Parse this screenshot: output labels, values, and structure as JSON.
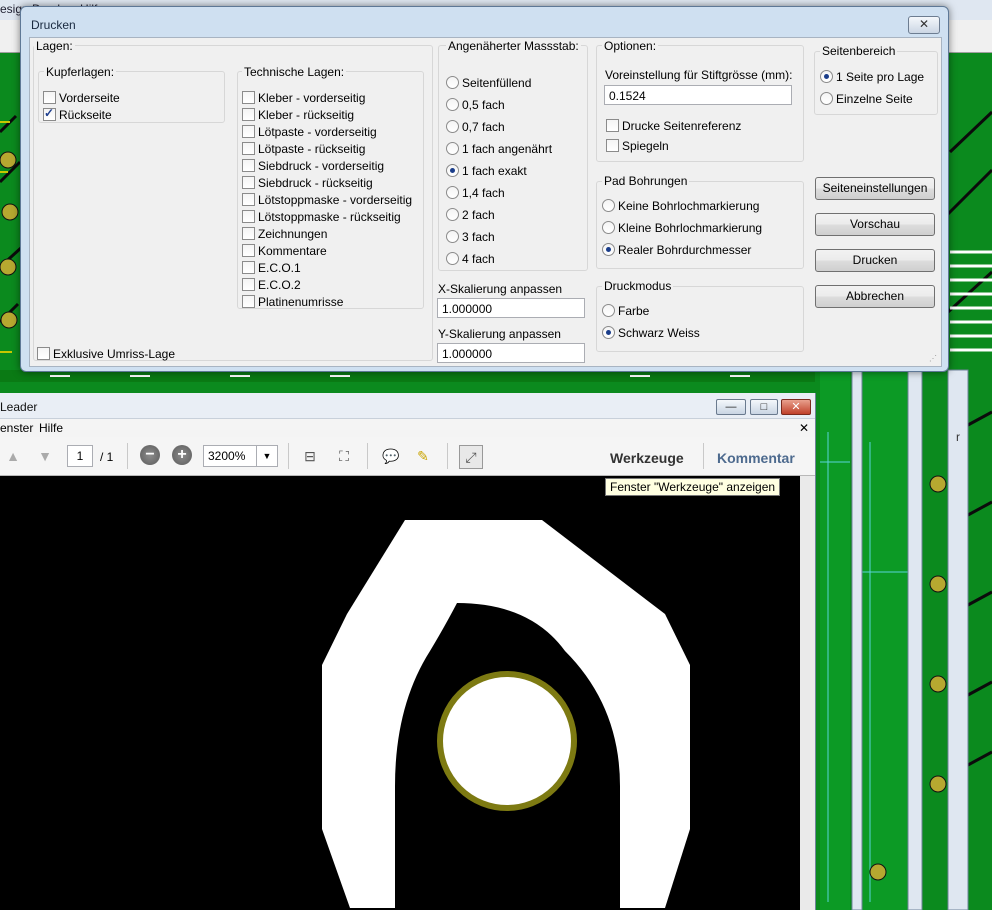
{
  "background": {
    "titlebar_text": "esign  Drucken  Hilfe",
    "right_panel_label": "r"
  },
  "print_dialog": {
    "title": "Drucken",
    "close_glyph": "✕",
    "layers": {
      "label": "Lagen:",
      "copper_label": "Kupferlagen:",
      "copper": [
        {
          "label": "Vorderseite",
          "checked": false
        },
        {
          "label": "Rückseite",
          "checked": true
        }
      ],
      "technical_label": "Technische Lagen:",
      "technical": [
        {
          "label": "Kleber - vorderseitig",
          "checked": false
        },
        {
          "label": "Kleber - rückseitig",
          "checked": false
        },
        {
          "label": "Lötpaste - vorderseitig",
          "checked": false
        },
        {
          "label": "Lötpaste - rückseitig",
          "checked": false
        },
        {
          "label": "Siebdruck - vorderseitig",
          "checked": false
        },
        {
          "label": "Siebdruck - rückseitig",
          "checked": false
        },
        {
          "label": "Lötstoppmaske - vorderseitig",
          "checked": false
        },
        {
          "label": "Lötstoppmaske - rückseitig",
          "checked": false
        },
        {
          "label": "Zeichnungen",
          "checked": false
        },
        {
          "label": "Kommentare",
          "checked": false
        },
        {
          "label": "E.C.O.1",
          "checked": false
        },
        {
          "label": "E.C.O.2",
          "checked": false
        },
        {
          "label": "Platinenumrisse",
          "checked": false
        }
      ],
      "exclusive_label": "Exklusive Umriss-Lage",
      "exclusive_checked": false
    },
    "scale": {
      "label": "Angenäherter Massstab:",
      "options": [
        {
          "label": "Seitenfüllend",
          "checked": false
        },
        {
          "label": "0,5 fach",
          "checked": false
        },
        {
          "label": "0,7 fach",
          "checked": false
        },
        {
          "label": "1 fach angenährt",
          "checked": false
        },
        {
          "label": "1 fach exakt",
          "checked": true
        },
        {
          "label": "1,4 fach",
          "checked": false
        },
        {
          "label": "2 fach",
          "checked": false
        },
        {
          "label": "3 fach",
          "checked": false
        },
        {
          "label": "4 fach",
          "checked": false
        }
      ],
      "x_label": "X-Skalierung anpassen",
      "x_value": "1.000000",
      "y_label": "Y-Skalierung anpassen",
      "y_value": "1.000000"
    },
    "options": {
      "label": "Optionen:",
      "pen_label": "Voreinstellung für Stiftgrösse (mm):",
      "pen_value": "0.1524",
      "page_ref_label": "Drucke Seitenreferenz",
      "page_ref_checked": false,
      "mirror_label": "Spiegeln",
      "mirror_checked": false
    },
    "pad_drill": {
      "label": "Pad Bohrungen",
      "options": [
        {
          "label": "Keine Bohrlochmarkierung",
          "checked": false
        },
        {
          "label": "Kleine Bohrlochmarkierung",
          "checked": false
        },
        {
          "label": "Realer Bohrdurchmesser",
          "checked": true
        }
      ]
    },
    "print_mode": {
      "label": "Druckmodus",
      "options": [
        {
          "label": "Farbe",
          "checked": false
        },
        {
          "label": "Schwarz Weiss",
          "checked": true
        }
      ]
    },
    "page_range": {
      "label": "Seitenbereich",
      "options": [
        {
          "label": "1 Seite pro Lage",
          "checked": true
        },
        {
          "label": "Einzelne Seite",
          "checked": false
        }
      ]
    },
    "buttons": {
      "page_setup": "Seiteneinstellungen",
      "preview": "Vorschau",
      "print": "Drucken",
      "cancel": "Abbrechen"
    }
  },
  "reader": {
    "title": "Leader",
    "minimize_glyph": "—",
    "maximize_glyph": "□",
    "close_glyph": "✕",
    "menu": [
      "enster",
      "Hilfe"
    ],
    "menu_close_glyph": "✕",
    "page_current": "1",
    "page_total": "/ 1",
    "zoom_value": "3200%",
    "zoom_out_glyph": "−",
    "zoom_in_glyph": "+",
    "tools_label": "Werkzeuge",
    "comment_label": "Kommentar",
    "tooltip": "Fenster \"Werkzeuge\" anzeigen"
  },
  "colors": {
    "pcb_green": "#0b8a1e",
    "pad_ring": "#7d7a12",
    "dialog_frame": "#cfe0f1"
  }
}
